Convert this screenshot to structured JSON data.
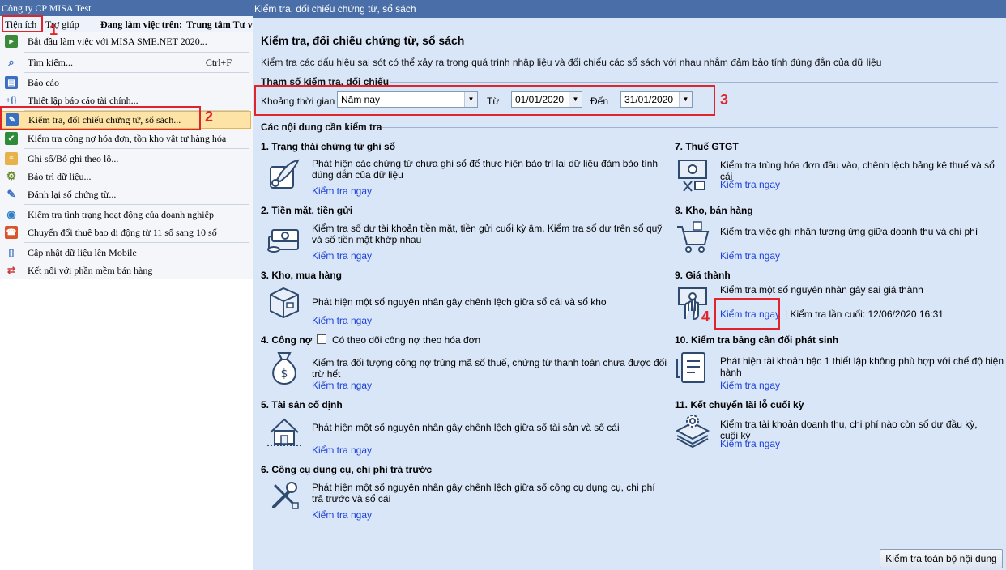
{
  "app": {
    "title": "Công ty CP MISA Test",
    "menubar": {
      "tien_ich": "Tiện ích",
      "tro_giup": "Trợ giúp",
      "working_label": "Đang làm việc trên:",
      "working_value": "Trung tâm Tư v"
    },
    "menu_items": [
      {
        "label": "Bắt đầu làm việc với MISA SME.NET 2020...",
        "icon": "start-icon",
        "color": "#3b8a3a"
      },
      {
        "label": "Tìm kiếm...",
        "shortcut": "Ctrl+F",
        "icon": "search-icon",
        "color": "#3a6fc2"
      },
      {
        "label": "Báo cáo",
        "icon": "report-icon",
        "color": "#3a6fc2"
      },
      {
        "label": "Thiết lập báo cáo tài chính...",
        "icon": "braces-icon",
        "color": "#2b5fb0"
      },
      {
        "label": "Kiểm tra, đối chiếu chứng từ, sổ sách...",
        "icon": "check-docs-icon",
        "color": "#3a6fc2"
      },
      {
        "label": "Kiểm tra công nợ hóa đơn, tồn kho vật tư hàng hóa",
        "icon": "checkbox-icon",
        "color": "#2e8b3a"
      },
      {
        "label": "Ghi sổ/Bỏ ghi theo lô...",
        "icon": "ledger-icon",
        "color": "#c88a2e"
      },
      {
        "label": "Bảo trì dữ liệu...",
        "icon": "gear-icon",
        "color": "#6a8a2e"
      },
      {
        "label": "Đánh lại số chứng từ...",
        "icon": "edit-icon",
        "color": "#3a6fc2"
      },
      {
        "label": "Kiểm tra tình trạng hoạt động của doanh nghiệp",
        "icon": "globe-icon",
        "color": "#2e7fc8"
      },
      {
        "label": "Chuyển đổi thuê bao di động từ 11 số sang 10 số",
        "icon": "phone-icon",
        "color": "#d9542c"
      },
      {
        "label": "Cập nhật dữ liệu lên Mobile",
        "icon": "mobile-icon",
        "color": "#3a6fc2"
      },
      {
        "label": "Kết nối với phần mềm bán hàng",
        "icon": "cart-link-icon",
        "color": "#c83a3a"
      }
    ]
  },
  "panel": {
    "window_title": "Kiểm tra, đối chiếu chứng từ, sổ sách",
    "heading": "Kiểm tra, đối chiếu chứng từ, sổ sách",
    "description": "Kiểm tra các dấu hiệu sai sót có thể xảy ra trong quá trình nhập liệu và đối chiếu các sổ sách với nhau nhằm đảm bảo tính đúng đắn của dữ liệu",
    "params_title": "Tham số kiểm tra, đối chiếu",
    "period_label": "Khoảng thời gian",
    "period_value": "Năm nay",
    "from_label": "Từ",
    "from_value": "01/01/2020",
    "to_label": "Đến",
    "to_value": "31/01/2020",
    "contents_title": "Các nội dung cần kiểm tra",
    "check_all_button": "Kiểm tra toàn bộ nội dung",
    "link_text": "Kiểm tra ngay",
    "sections_left": [
      {
        "title": "1. Trạng thái chứng từ ghi sổ",
        "desc": "Phát hiện các chứng từ chưa ghi sổ để thực hiện bảo trì lại dữ liệu đảm bảo tính đúng đắn của dữ liệu",
        "icon": "quill-icon"
      },
      {
        "title": "2. Tiền mặt, tiền gửi",
        "desc": "Kiểm tra số dư tài khoản tiền mặt, tiền gửi cuối kỳ âm. Kiểm tra số dư trên sổ quỹ và số tiền mặt khớp nhau",
        "icon": "money-icon"
      },
      {
        "title": "3. Kho, mua hàng",
        "desc": "Phát hiện một số nguyên nhân gây chênh lệch giữa sổ cái và sổ kho",
        "icon": "box-icon"
      },
      {
        "title": "4. Công nợ",
        "checkbox_label": "Có theo dõi công nợ theo hóa đơn",
        "desc": "Kiểm tra đối tượng công nợ trùng mã số thuế, chứng từ thanh toán chưa được đối trừ hết",
        "icon": "money-bag-icon"
      },
      {
        "title": "5. Tài sản cố định",
        "desc": "Phát hiện một số nguyên nhân gây chênh lệch giữa sổ tài sản và sổ cái",
        "icon": "house-icon"
      },
      {
        "title": "6. Công cụ dụng cụ, chi phí trả trước",
        "desc": "Phát hiện một số nguyên nhân gây chênh lệch giữa sổ công cụ dụng cụ, chi phí trả trước và sổ cái",
        "icon": "tools-icon"
      }
    ],
    "sections_right": [
      {
        "title": "7. Thuế GTGT",
        "desc": "Kiểm tra trùng hóa đơn đầu vào, chênh lệch bảng kê thuế và sổ cái",
        "icon": "tax-icon"
      },
      {
        "title": "8. Kho, bán hàng",
        "desc": "Kiểm tra việc ghi nhận tương ứng giữa doanh thu và chi phí",
        "icon": "cart-icon"
      },
      {
        "title": "9. Giá thành",
        "desc": "Kiểm tra một số nguyên nhân gây sai giá thành",
        "last_check": "| Kiểm tra lần cuối: 12/06/2020 16:31",
        "icon": "hand-money-icon"
      },
      {
        "title": "10. Kiểm tra bảng cân đối phát sinh",
        "desc": "Phát hiện tài khoản bậc 1 thiết lập không phù hợp với chế độ hiện hành",
        "icon": "balance-icon"
      },
      {
        "title": "11. Kết chuyển lãi lỗ cuối kỳ",
        "desc": "Kiểm tra tài khoản doanh thu, chi phí nào còn số dư đầu kỳ, cuối kỳ",
        "icon": "layers-gear-icon"
      }
    ]
  },
  "annotations": {
    "n1": "1",
    "n2": "2",
    "n3": "3",
    "n4": "4",
    "color": "#e0242c"
  }
}
